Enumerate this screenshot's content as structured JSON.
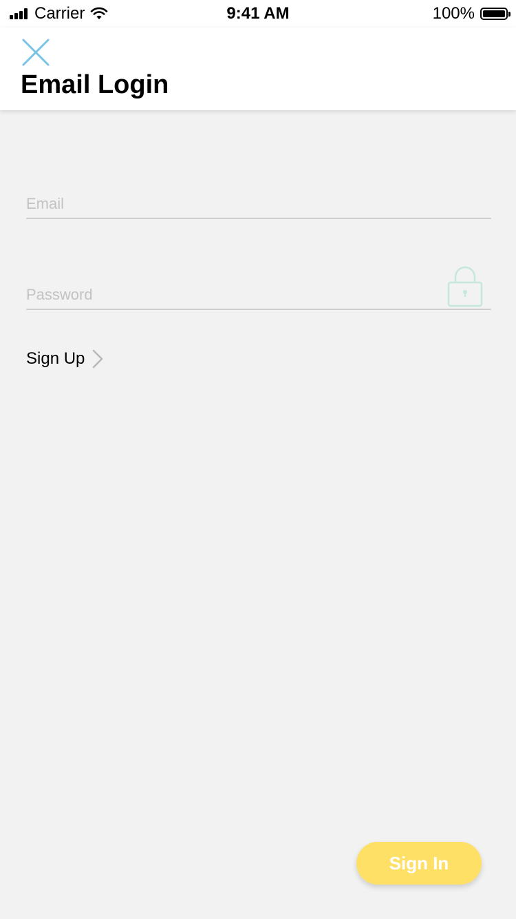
{
  "status_bar": {
    "carrier": "Carrier",
    "time": "9:41 AM",
    "battery": "100%"
  },
  "header": {
    "title": "Email Login",
    "close_icon": "close-icon"
  },
  "form": {
    "email_placeholder": "Email",
    "email_value": "",
    "password_placeholder": "Password",
    "password_value": "",
    "lock_icon": "lock-icon"
  },
  "signup": {
    "label": "Sign Up",
    "icon": "chevron-right-icon"
  },
  "sign_in": {
    "label": "Sign In"
  },
  "colors": {
    "close_icon": "#78c4e6",
    "lock_icon": "#c6e8dc",
    "sign_in_button": "#ffe066",
    "background": "#f2f2f2"
  }
}
